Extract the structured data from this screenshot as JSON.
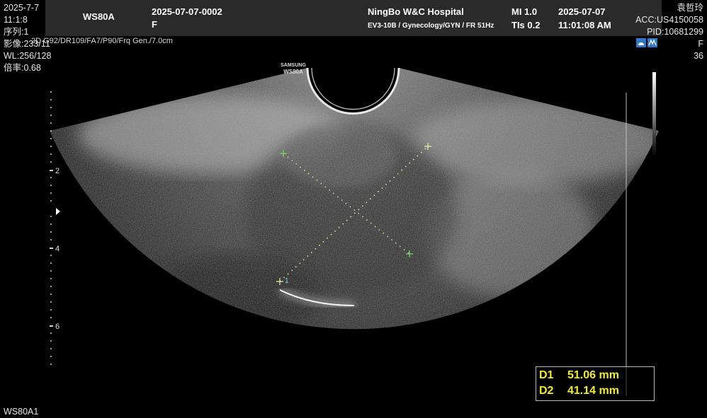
{
  "header": {
    "machine": "WS80A",
    "exam_id": "2025-07-07-0002",
    "sex": "F",
    "hospital": "NingBo W&C Hospital",
    "probe_info": "EV3-10B / Gynecology/GYN / FR 51Hz",
    "mi": "MI  1.0",
    "tis": "TIs 0.2",
    "date": "2025-07-07",
    "time": "11:01:08 AM"
  },
  "left_info": {
    "date": "2025-7-7",
    "time": "11:1:8",
    "series": "序列:1",
    "image": "影像:233/11",
    "wl": "WL:256/128",
    "zoom": "倍率:0.68",
    "params": "2D G92/DR109/FA7/P90/Frq Gen./7.0cm",
    "footer": "WS80A1"
  },
  "right_info": {
    "patient_name": "袁哲玲",
    "acc": "ACC:US4150058",
    "pid": "PID:10681299",
    "sex": "F",
    "age": "36"
  },
  "probe_label": {
    "line1": "SAMSUNG",
    "line2": "WS80A"
  },
  "depth_scale": {
    "labels": [
      "2",
      "4",
      "6"
    ]
  },
  "measurements": [
    {
      "label": "D1",
      "value": "51.06 mm"
    },
    {
      "label": "D2",
      "value": "41.14 mm"
    }
  ],
  "caliper_marks": {
    "d2_end_label": "1"
  },
  "colors": {
    "header_bg": "#2a2a2a",
    "measurement_text": "#f1ee1e",
    "caliper": "#7fd36a",
    "mode_icon": "#2f78c8"
  }
}
